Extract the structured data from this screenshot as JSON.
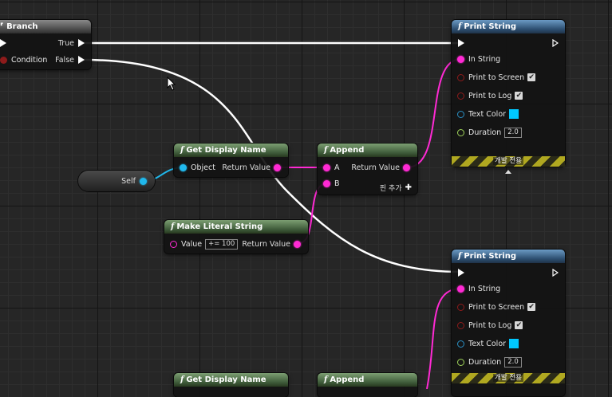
{
  "nodes": {
    "branch": {
      "title": "Branch",
      "pins": {
        "true": "True",
        "condition": "Condition",
        "false": "False"
      }
    },
    "print1": {
      "title": "Print String",
      "in_string": "In String",
      "print_to_screen": "Print to Screen",
      "print_to_log": "Print to Log",
      "text_color": "Text Color",
      "duration": "Duration",
      "duration_value": "2.0",
      "dev_only": "개발 전용",
      "check": "✔"
    },
    "print2": {
      "title": "Print String",
      "in_string": "In String",
      "print_to_screen": "Print to Screen",
      "print_to_log": "Print to Log",
      "text_color": "Text Color",
      "duration": "Duration",
      "duration_value": "2.0",
      "dev_only": "개발 전용",
      "check": "✔"
    },
    "get_display_name": {
      "title": "Get Display Name",
      "object": "Object",
      "return_value": "Return Value"
    },
    "get_display_name_2": {
      "title": "Get Display Name"
    },
    "append": {
      "title": "Append",
      "a": "A",
      "b": "B",
      "return_value": "Return Value",
      "add_pin": "핀 추가",
      "plus": "✚"
    },
    "append_2": {
      "title": "Append"
    },
    "make_literal_string": {
      "title": "Make Literal String",
      "value": "Value",
      "value_text": "+= 100",
      "return_value": "Return Value"
    },
    "self": {
      "label": "Self"
    }
  },
  "colors": {
    "string_pin": "#ff2ad4",
    "object_pin": "#20b8ec",
    "exec_wire": "#ffffff",
    "bool_pin": "#8e1b1b",
    "text_color_swatch": "#00c8ff"
  }
}
